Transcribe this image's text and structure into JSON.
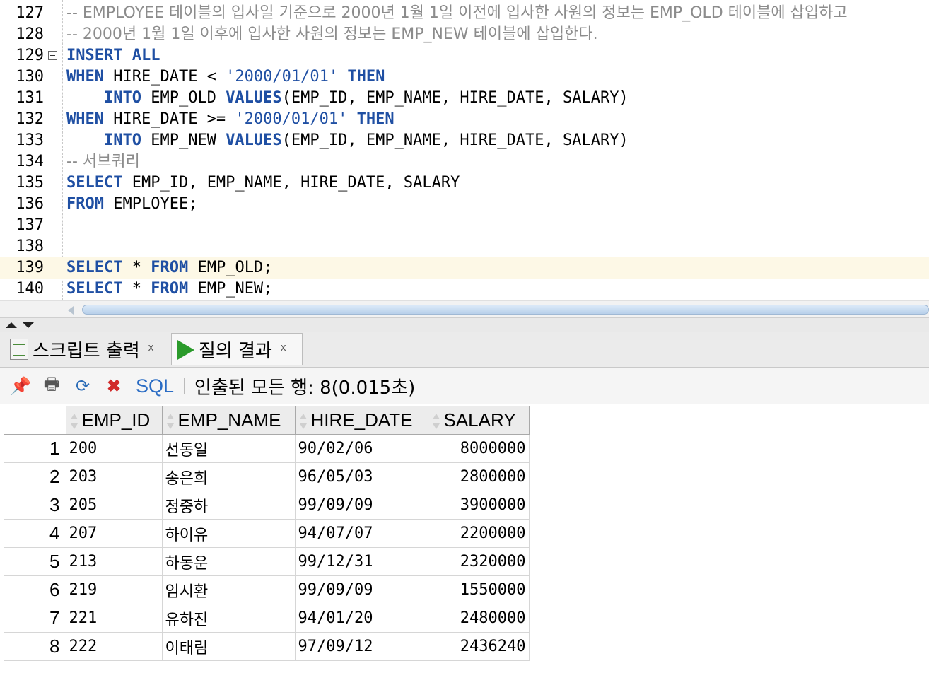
{
  "editor": {
    "lines": [
      {
        "num": "127",
        "segments": [
          {
            "t": "-- EMPLOYEE 테이블의 입사일 기준으로 2000년 1월 1일 이전에 입사한 사원의 정보는 EMP_OLD 테이블에 삽입하고",
            "c": "cm"
          }
        ]
      },
      {
        "num": "128",
        "segments": [
          {
            "t": "-- 2000년 1월 1일 이후에 입사한 사원의 정보는 EMP_NEW 테이블에 삽입한다.",
            "c": "cm"
          }
        ]
      },
      {
        "num": "129",
        "fold": true,
        "segments": [
          {
            "t": "INSERT ALL",
            "c": "kw"
          }
        ]
      },
      {
        "num": "130",
        "segments": [
          {
            "t": "WHEN",
            "c": "kw"
          },
          {
            "t": " HIRE_DATE < ",
            "c": ""
          },
          {
            "t": "'2000/01/01'",
            "c": "str"
          },
          {
            "t": " ",
            "c": ""
          },
          {
            "t": "THEN",
            "c": "kw"
          }
        ]
      },
      {
        "num": "131",
        "segments": [
          {
            "t": "    ",
            "c": ""
          },
          {
            "t": "INTO",
            "c": "kw"
          },
          {
            "t": " EMP_OLD ",
            "c": ""
          },
          {
            "t": "VALUES",
            "c": "kw"
          },
          {
            "t": "(EMP_ID, EMP_NAME, HIRE_DATE, SALARY)",
            "c": ""
          }
        ]
      },
      {
        "num": "132",
        "segments": [
          {
            "t": "WHEN",
            "c": "kw"
          },
          {
            "t": " HIRE_DATE >= ",
            "c": ""
          },
          {
            "t": "'2000/01/01'",
            "c": "str"
          },
          {
            "t": " ",
            "c": ""
          },
          {
            "t": "THEN",
            "c": "kw"
          }
        ]
      },
      {
        "num": "133",
        "segments": [
          {
            "t": "    ",
            "c": ""
          },
          {
            "t": "INTO",
            "c": "kw"
          },
          {
            "t": " EMP_NEW ",
            "c": ""
          },
          {
            "t": "VALUES",
            "c": "kw"
          },
          {
            "t": "(EMP_ID, EMP_NAME, HIRE_DATE, SALARY)",
            "c": ""
          }
        ]
      },
      {
        "num": "134",
        "segments": [
          {
            "t": "-- 서브쿼리",
            "c": "cm"
          }
        ]
      },
      {
        "num": "135",
        "segments": [
          {
            "t": "SELECT",
            "c": "kw"
          },
          {
            "t": " EMP_ID, EMP_NAME, HIRE_DATE, SALARY",
            "c": ""
          }
        ]
      },
      {
        "num": "136",
        "segments": [
          {
            "t": "FROM",
            "c": "kw"
          },
          {
            "t": " EMPLOYEE;",
            "c": ""
          }
        ]
      },
      {
        "num": "137",
        "segments": []
      },
      {
        "num": "138",
        "segments": []
      },
      {
        "num": "139",
        "highlight": true,
        "segments": [
          {
            "t": "SELECT",
            "c": "kw"
          },
          {
            "t": " * ",
            "c": ""
          },
          {
            "t": "FROM",
            "c": "kw"
          },
          {
            "t": " EMP_OLD;",
            "c": ""
          }
        ]
      },
      {
        "num": "140",
        "segments": [
          {
            "t": "SELECT",
            "c": "kw"
          },
          {
            "t": " * ",
            "c": ""
          },
          {
            "t": "FROM",
            "c": "kw"
          },
          {
            "t": " EMP_NEW;",
            "c": ""
          }
        ]
      }
    ]
  },
  "tabs": {
    "script_output": "스크립트 출력",
    "query_result": "질의 결과",
    "close": "x"
  },
  "toolbar": {
    "sql_label": "SQL",
    "status": "인출된 모든 행: 8(0.015초)"
  },
  "grid": {
    "columns": [
      "EMP_ID",
      "EMP_NAME",
      "HIRE_DATE",
      "SALARY"
    ],
    "rows": [
      {
        "n": "1",
        "emp_id": "200",
        "emp_name": "선동일",
        "hire_date": "90/02/06",
        "salary": "8000000"
      },
      {
        "n": "2",
        "emp_id": "203",
        "emp_name": "송은희",
        "hire_date": "96/05/03",
        "salary": "2800000"
      },
      {
        "n": "3",
        "emp_id": "205",
        "emp_name": "정중하",
        "hire_date": "99/09/09",
        "salary": "3900000"
      },
      {
        "n": "4",
        "emp_id": "207",
        "emp_name": "하이유",
        "hire_date": "94/07/07",
        "salary": "2200000"
      },
      {
        "n": "5",
        "emp_id": "213",
        "emp_name": "하동운",
        "hire_date": "99/12/31",
        "salary": "2320000"
      },
      {
        "n": "6",
        "emp_id": "219",
        "emp_name": "임시환",
        "hire_date": "99/09/09",
        "salary": "1550000"
      },
      {
        "n": "7",
        "emp_id": "221",
        "emp_name": "유하진",
        "hire_date": "94/01/20",
        "salary": "2480000"
      },
      {
        "n": "8",
        "emp_id": "222",
        "emp_name": "이태림",
        "hire_date": "97/09/12",
        "salary": "2436240"
      }
    ]
  }
}
